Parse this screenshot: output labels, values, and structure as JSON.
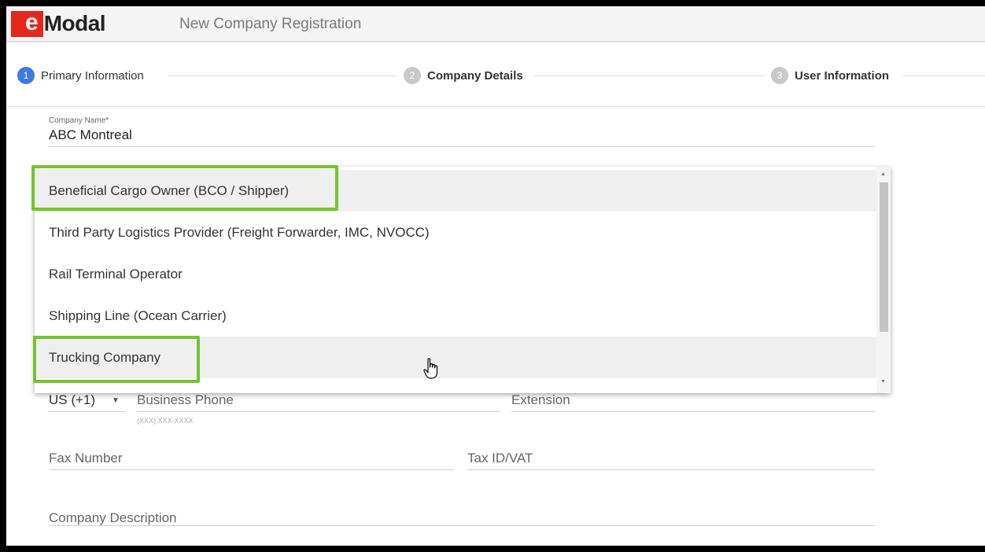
{
  "header": {
    "logo_e": "e",
    "logo_rest": "Modal",
    "title": "New Company Registration"
  },
  "stepper": {
    "steps": [
      {
        "number": "1",
        "label": "Primary Information",
        "state": "active"
      },
      {
        "number": "2",
        "label": "Company Details",
        "state": "inactive"
      },
      {
        "number": "3",
        "label": "User Information",
        "state": "inactive"
      }
    ]
  },
  "form": {
    "company_name": {
      "label": "Company Name",
      "required_mark": "*",
      "value": "ABC Montreal"
    },
    "country_code": {
      "value": "US (+1)"
    },
    "business_phone": {
      "placeholder": "Business Phone",
      "hint": "(XXX) XXX-XXXX"
    },
    "extension": {
      "placeholder": "Extension"
    },
    "fax_number": {
      "placeholder": "Fax Number"
    },
    "tax_id": {
      "placeholder": "Tax ID/VAT"
    },
    "company_description": {
      "placeholder": "Company Description"
    }
  },
  "dropdown": {
    "options": [
      {
        "label": "Beneficial Cargo Owner (BCO / Shipper)",
        "highlighted": true,
        "callout": true
      },
      {
        "label": "Third Party Logistics Provider (Freight Forwarder, IMC, NVOCC)",
        "highlighted": false,
        "callout": false
      },
      {
        "label": "Rail Terminal Operator",
        "highlighted": false,
        "callout": false
      },
      {
        "label": "Shipping Line (Ocean Carrier)",
        "highlighted": false,
        "callout": false
      },
      {
        "label": "Trucking Company",
        "highlighted": true,
        "callout": true
      }
    ]
  },
  "colors": {
    "accent_blue": "#3b7ae0",
    "brand_red": "#e4281c",
    "callout_green": "#73c52b"
  }
}
